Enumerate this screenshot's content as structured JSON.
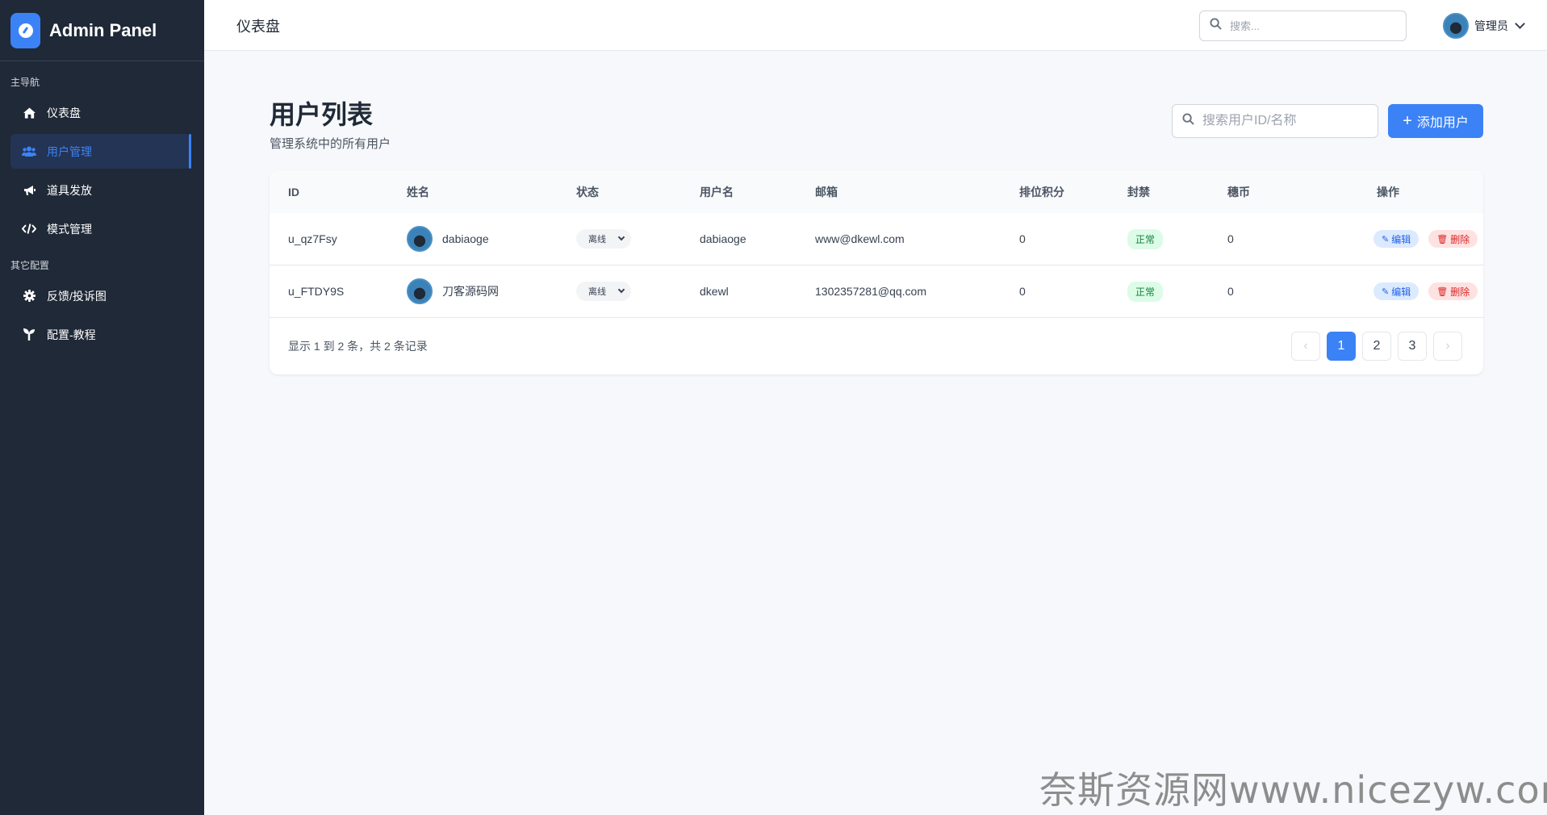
{
  "sidebar": {
    "brand": "Admin Panel",
    "section_main": "主导航",
    "section_other": "其它配置",
    "items": [
      {
        "label": "仪表盘",
        "icon": "home-icon"
      },
      {
        "label": "用户管理",
        "icon": "users-icon",
        "active": true
      },
      {
        "label": "道具发放",
        "icon": "megaphone-icon"
      },
      {
        "label": "模式管理",
        "icon": "code-icon"
      },
      {
        "label": "反馈/投诉图",
        "icon": "gear-icon"
      },
      {
        "label": "配置-教程",
        "icon": "seedling-icon"
      }
    ]
  },
  "topbar": {
    "title": "仪表盘",
    "search_placeholder": "搜索...",
    "user_name": "管理员"
  },
  "main": {
    "title": "用户列表",
    "subtitle": "管理系统中的所有用户",
    "search_placeholder": "搜索用户ID/名称",
    "add_button": "添加用户"
  },
  "table": {
    "headers": [
      "ID",
      "姓名",
      "状态",
      "用户名",
      "邮箱",
      "排位积分",
      "封禁",
      "穗币",
      "操作"
    ],
    "rows": [
      {
        "id": "u_qz7Fsy",
        "name": "dabiaoge",
        "status": "离线",
        "username": "dabiaoge",
        "email": "www@dkewl.com",
        "rank": "0",
        "ban": "正常",
        "coin": "0"
      },
      {
        "id": "u_FTDY9S",
        "name": "刀客源码网",
        "status": "离线",
        "username": "dkewl",
        "email": "1302357281@qq.com",
        "rank": "0",
        "ban": "正常",
        "coin": "0"
      }
    ],
    "edit_label": "编辑",
    "delete_label": "删除",
    "footer_info": "显示 1 到 2 条，共 2 条记录",
    "pages": [
      "1",
      "2",
      "3"
    ],
    "current_page": "1"
  },
  "watermark": "奈斯资源网www.nicezyw.com",
  "colors": {
    "accent": "#3b82f6",
    "sidebar_bg": "#1f2937"
  }
}
